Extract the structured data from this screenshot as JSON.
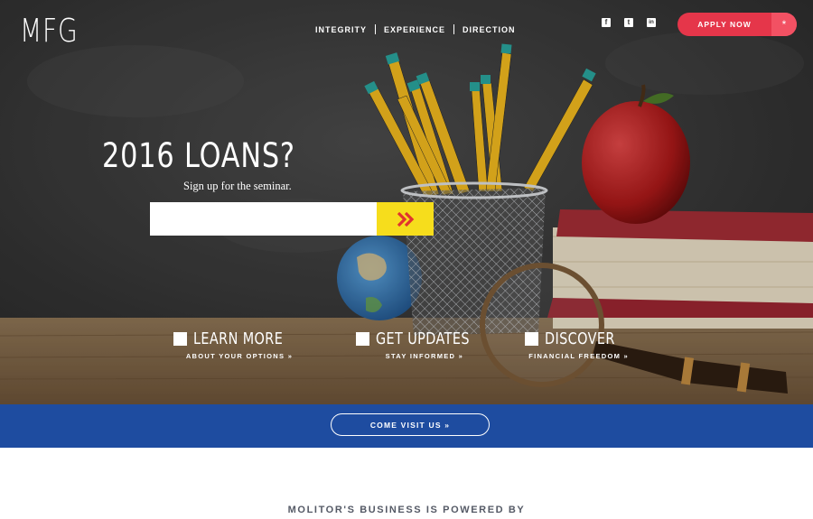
{
  "brand": {
    "logo": "MFG"
  },
  "nav": {
    "items": [
      {
        "label": "INTEGRITY"
      },
      {
        "label": "EXPERIENCE"
      },
      {
        "label": "DIRECTION"
      }
    ]
  },
  "social": {
    "items": [
      {
        "icon": "facebook-icon",
        "glyph": "f"
      },
      {
        "icon": "twitter-icon",
        "glyph": "t"
      },
      {
        "icon": "linkedin-icon",
        "glyph": "in"
      }
    ]
  },
  "apply": {
    "label": "APPLY NOW",
    "icon": "*"
  },
  "hero": {
    "headline": "2016 LOANS?",
    "subline": "Sign up for the seminar.",
    "email_placeholder": "",
    "submit_icon": "»"
  },
  "features": [
    {
      "title": "LEARN MORE",
      "subtitle": "ABOUT YOUR OPTIONS  »"
    },
    {
      "title": "GET UPDATES",
      "subtitle": "STAY INFORMED  »"
    },
    {
      "title": "DISCOVER",
      "subtitle": "FINANCIAL FREEDOM  »"
    }
  ],
  "band": {
    "button_label": "COME VISIT US  »"
  },
  "footer": {
    "powered_by": "MOLITOR'S BUSINESS IS POWERED BY"
  },
  "colors": {
    "accent_red": "#e5364a",
    "band_blue": "#1e4ca0",
    "submit_yellow": "#f6dd1c"
  }
}
